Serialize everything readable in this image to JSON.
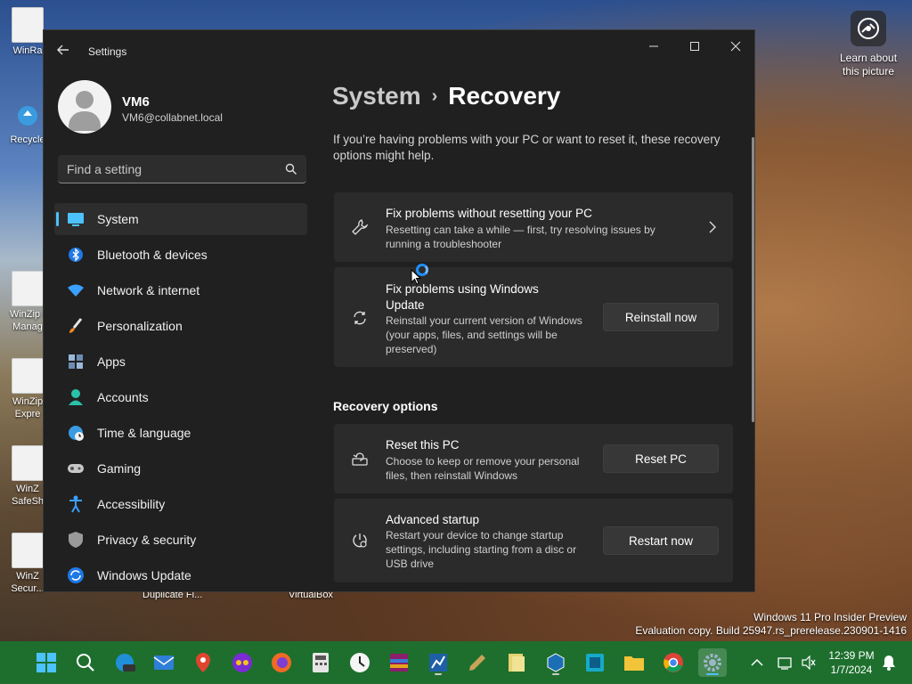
{
  "desktop": {
    "icons": [
      {
        "label": "WinRa"
      },
      {
        "label": "Recycle"
      },
      {
        "label": "WinZip I\nManag"
      },
      {
        "label": "WinZip\nExpre"
      },
      {
        "label": "WinZ\nSafeSh"
      },
      {
        "label": "WinZ\nSecur..."
      }
    ],
    "bottom_labels": {
      "duplicate": "Duplicate Fi...",
      "virtualbox": "VirtualBox"
    },
    "learn_label": "Learn about this picture",
    "watermark_line1": "Windows 11 Pro Insider Preview",
    "watermark_line2": "Evaluation copy. Build 25947.rs_prerelease.230901-1416"
  },
  "window": {
    "title": "Settings",
    "user": {
      "name": "VM6",
      "email": "VM6@collabnet.local"
    },
    "search": {
      "placeholder": "Find a setting"
    },
    "nav": [
      {
        "label": "System",
        "icon": "monitor-icon",
        "active": true
      },
      {
        "label": "Bluetooth & devices",
        "icon": "bluetooth-icon"
      },
      {
        "label": "Network & internet",
        "icon": "wifi-icon"
      },
      {
        "label": "Personalization",
        "icon": "brush-icon"
      },
      {
        "label": "Apps",
        "icon": "apps-icon"
      },
      {
        "label": "Accounts",
        "icon": "person-icon"
      },
      {
        "label": "Time & language",
        "icon": "globe-clock-icon"
      },
      {
        "label": "Gaming",
        "icon": "gamepad-icon"
      },
      {
        "label": "Accessibility",
        "icon": "accessibility-icon"
      },
      {
        "label": "Privacy & security",
        "icon": "shield-icon"
      },
      {
        "label": "Windows Update",
        "icon": "update-icon"
      }
    ],
    "breadcrumb": {
      "parent": "System",
      "separator": "›",
      "current": "Recovery"
    },
    "intro": "If you’re having problems with your PC or want to reset it, these recovery options might help.",
    "cards": {
      "fix_no_reset": {
        "title": "Fix problems without resetting your PC",
        "desc": "Resetting can take a while — first, try resolving issues by running a troubleshooter"
      },
      "fix_update": {
        "title": "Fix problems using Windows Update",
        "desc": "Reinstall your current version of Windows (your apps, files, and settings will be preserved)",
        "button": "Reinstall now"
      }
    },
    "recovery_options_title": "Recovery options",
    "recovery": {
      "reset": {
        "title": "Reset this PC",
        "desc": "Choose to keep or remove your personal files, then reinstall Windows",
        "button": "Reset PC"
      },
      "advanced": {
        "title": "Advanced startup",
        "desc": "Restart your device to change startup settings, including starting from a disc or USB drive",
        "button": "Restart now"
      }
    }
  },
  "taskbar": {
    "time": "12:39 PM",
    "date": "1/7/2024",
    "accent": "#1e6f2e"
  }
}
